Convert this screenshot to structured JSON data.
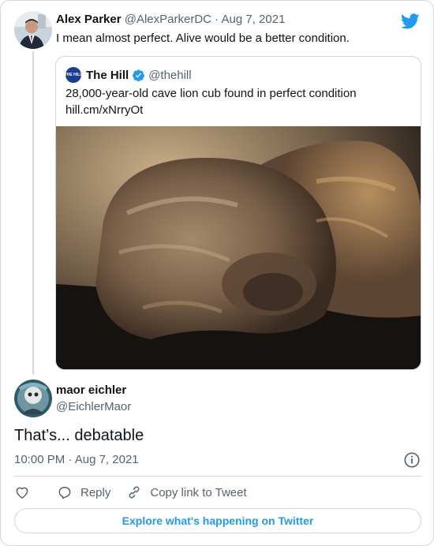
{
  "parent_tweet": {
    "author_name": "Alex Parker",
    "author_handle": "@AlexParkerDC",
    "separator": "·",
    "date": "Aug 7, 2021",
    "text": "I mean almost perfect. Alive would be a better condition."
  },
  "quoted_tweet": {
    "avatar_text": "THE HILL",
    "author_name": "The Hill",
    "author_handle": "@thehill",
    "text_line1": "28,000-year-old cave lion cub found in perfect condition",
    "text_line2": "hill.cm/xNrryOt",
    "image_icon": "cave-lion-cub-photo"
  },
  "reply_tweet": {
    "author_name": "maor eichler",
    "author_handle": "@EichlerMaor",
    "text": "That’s... debatable",
    "time": "10:00 PM",
    "separator": "·",
    "date": "Aug 7, 2021"
  },
  "actions": {
    "like_icon": "heart-icon",
    "reply_label": "Reply",
    "copy_label": "Copy link to Tweet"
  },
  "footer": {
    "explore_label": "Explore what's happening on Twitter"
  },
  "colors": {
    "accent": "#1d9bf0",
    "text": "#0f1419",
    "muted": "#536471",
    "border": "#cfd9de"
  }
}
